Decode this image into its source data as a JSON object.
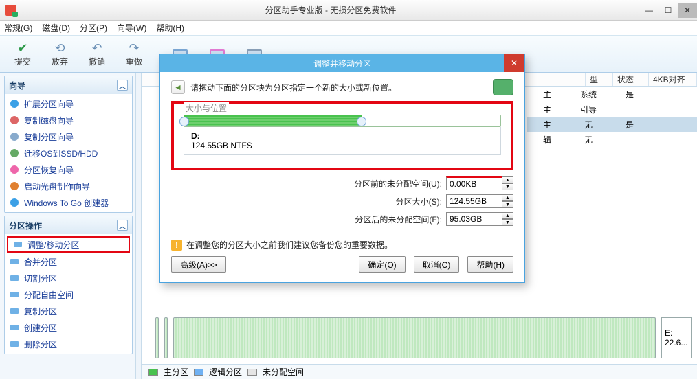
{
  "window": {
    "title": "分区助手专业版 - 无损分区免费软件"
  },
  "menu": {
    "items": [
      "常规(G)",
      "磁盘(D)",
      "分区(P)",
      "向导(W)",
      "帮助(H)"
    ]
  },
  "toolbar": {
    "commit": "提交",
    "discard": "放弃",
    "undo": "撤销",
    "redo": "重做"
  },
  "left": {
    "wizard": {
      "title": "向导",
      "items": [
        "扩展分区向导",
        "复制磁盘向导",
        "复制分区向导",
        "迁移OS到SSD/HDD",
        "分区恢复向导",
        "启动光盘制作向导",
        "Windows To Go 创建器"
      ]
    },
    "ops": {
      "title": "分区操作",
      "items": [
        "调整/移动分区",
        "合并分区",
        "切割分区",
        "分配自由空间",
        "复制分区",
        "创建分区",
        "删除分区"
      ]
    }
  },
  "table": {
    "headers": [
      "型",
      "状态",
      "4KB对齐"
    ],
    "rows": [
      {
        "c1": "主",
        "c2": "系统",
        "c3": "是"
      },
      {
        "c1": "主",
        "c2": "引导",
        "c3": ""
      },
      {
        "c1": "主",
        "c2": "无",
        "c3": "是",
        "sel": true
      },
      {
        "c1": "辑",
        "c2": "无",
        "c3": ""
      }
    ]
  },
  "legend": {
    "main": "主分区",
    "logic": "逻辑分区",
    "free": "未分配空间"
  },
  "diskright": {
    "label": "E:",
    "size": "22.6..."
  },
  "dialog": {
    "title": "调整并移动分区",
    "instruction": "请拖动下面的分区块为分区指定一个新的大小或新位置。",
    "group_label": "大小与位置",
    "drive": "D:",
    "drive_info": "124.55GB NTFS",
    "fields": {
      "before": {
        "label": "分区前的未分配空间(U):",
        "value": "0.00KB"
      },
      "size": {
        "label": "分区大小(S):",
        "value": "124.55GB"
      },
      "after": {
        "label": "分区后的未分配空间(F):",
        "value": "95.03GB"
      }
    },
    "warning": "在调整您的分区大小之前我们建议您备份您的重要数据。",
    "buttons": {
      "advanced": "高级(A)>>",
      "ok": "确定(O)",
      "cancel": "取消(C)",
      "help": "帮助(H)"
    }
  }
}
